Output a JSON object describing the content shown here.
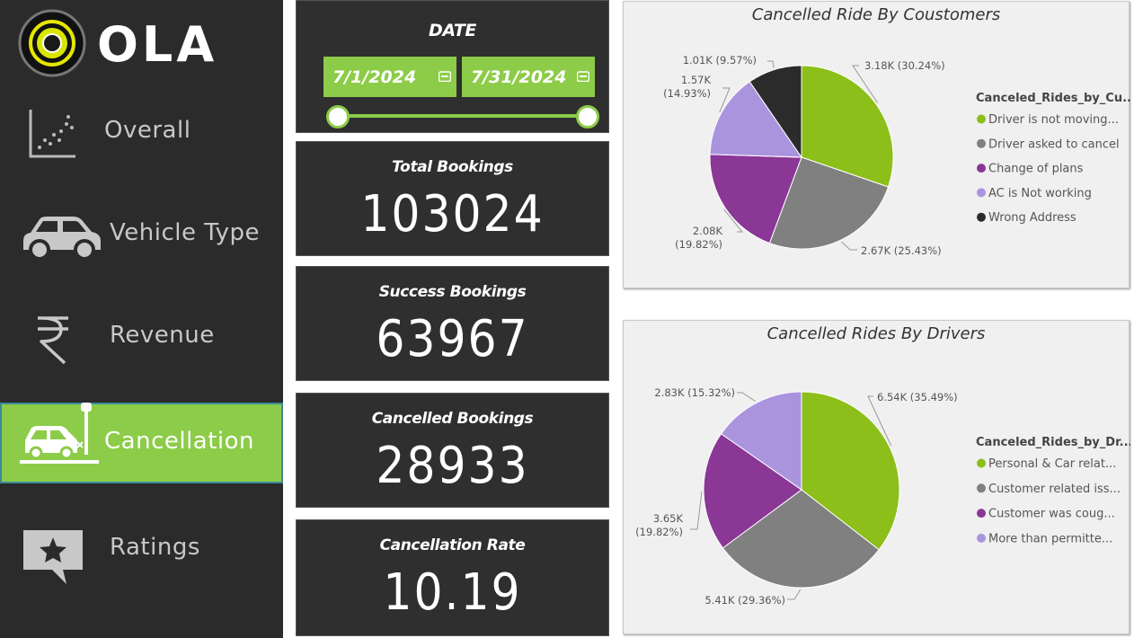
{
  "brand": {
    "name": "OLA"
  },
  "sidebar": {
    "items": [
      {
        "label": "Overall",
        "icon": "scatter-chart-icon",
        "active": false
      },
      {
        "label": "Vehicle Type",
        "icon": "car-icon",
        "active": false
      },
      {
        "label": "Revenue",
        "icon": "rupee-icon",
        "active": false
      },
      {
        "label": "Cancellation",
        "icon": "car-crash-icon",
        "active": true
      },
      {
        "label": "Ratings",
        "icon": "star-review-icon",
        "active": false
      }
    ]
  },
  "date_filter": {
    "title": "DATE",
    "start": "7/1/2024",
    "end": "7/31/2024"
  },
  "kpis": {
    "total_bookings": {
      "label": "Total Bookings",
      "value": "103024"
    },
    "success_bookings": {
      "label": "Success Bookings",
      "value": "63967"
    },
    "cancelled_bookings": {
      "label": "Cancelled Bookings",
      "value": "28933"
    },
    "cancellation_rate": {
      "label": "Cancellation Rate",
      "value": "10.19"
    }
  },
  "colors": {
    "accent": "#8ccc48",
    "sidebar_bg": "#2b2b2b",
    "card_bg": "#2f2f2f",
    "panel_bg": "#f0f0f0"
  },
  "chart_data": [
    {
      "type": "pie",
      "title": "Cancelled Ride By Coustomers",
      "legend_title": "Canceled_Rides_by_Cu...",
      "legend_position": "right",
      "slices": [
        {
          "name": "Driver is not moving...",
          "value": 3.18,
          "unit": "K",
          "percent": 30.24,
          "label": "3.18K (30.24%)",
          "color": "#8cbf1a"
        },
        {
          "name": "Driver asked to cancel",
          "value": 2.67,
          "unit": "K",
          "percent": 25.43,
          "label": "2.67K (25.43%)",
          "color": "#808080"
        },
        {
          "name": "Change of plans",
          "value": 2.08,
          "unit": "K",
          "percent": 19.82,
          "label_value": "2.08K",
          "label_pct": "(19.82%)",
          "color": "#8a3796"
        },
        {
          "name": "AC is Not working",
          "value": 1.57,
          "unit": "K",
          "percent": 14.93,
          "label_value": "1.57K",
          "label_pct": "(14.93%)",
          "color": "#ab94de"
        },
        {
          "name": "Wrong Address",
          "value": 1.01,
          "unit": "K",
          "percent": 9.57,
          "label": "1.01K (9.57%)",
          "color": "#2b2b2b"
        }
      ]
    },
    {
      "type": "pie",
      "title": "Cancelled Rides By Drivers",
      "legend_title": "Canceled_Rides_by_Dr...",
      "legend_position": "right",
      "slices": [
        {
          "name": "Personal & Car relat...",
          "value": 6.54,
          "unit": "K",
          "percent": 35.49,
          "label": "6.54K (35.49%)",
          "color": "#8cbf1a"
        },
        {
          "name": "Customer related iss...",
          "value": 5.41,
          "unit": "K",
          "percent": 29.36,
          "label": "5.41K (29.36%)",
          "color": "#808080"
        },
        {
          "name": "Customer was coug...",
          "value": 3.65,
          "unit": "K",
          "percent": 19.82,
          "label_value": "3.65K",
          "label_pct": "(19.82%)",
          "color": "#8a3796"
        },
        {
          "name": "More than permitte...",
          "value": 2.83,
          "unit": "K",
          "percent": 15.32,
          "label": "2.83K (15.32%)",
          "color": "#ab94de"
        }
      ]
    }
  ]
}
